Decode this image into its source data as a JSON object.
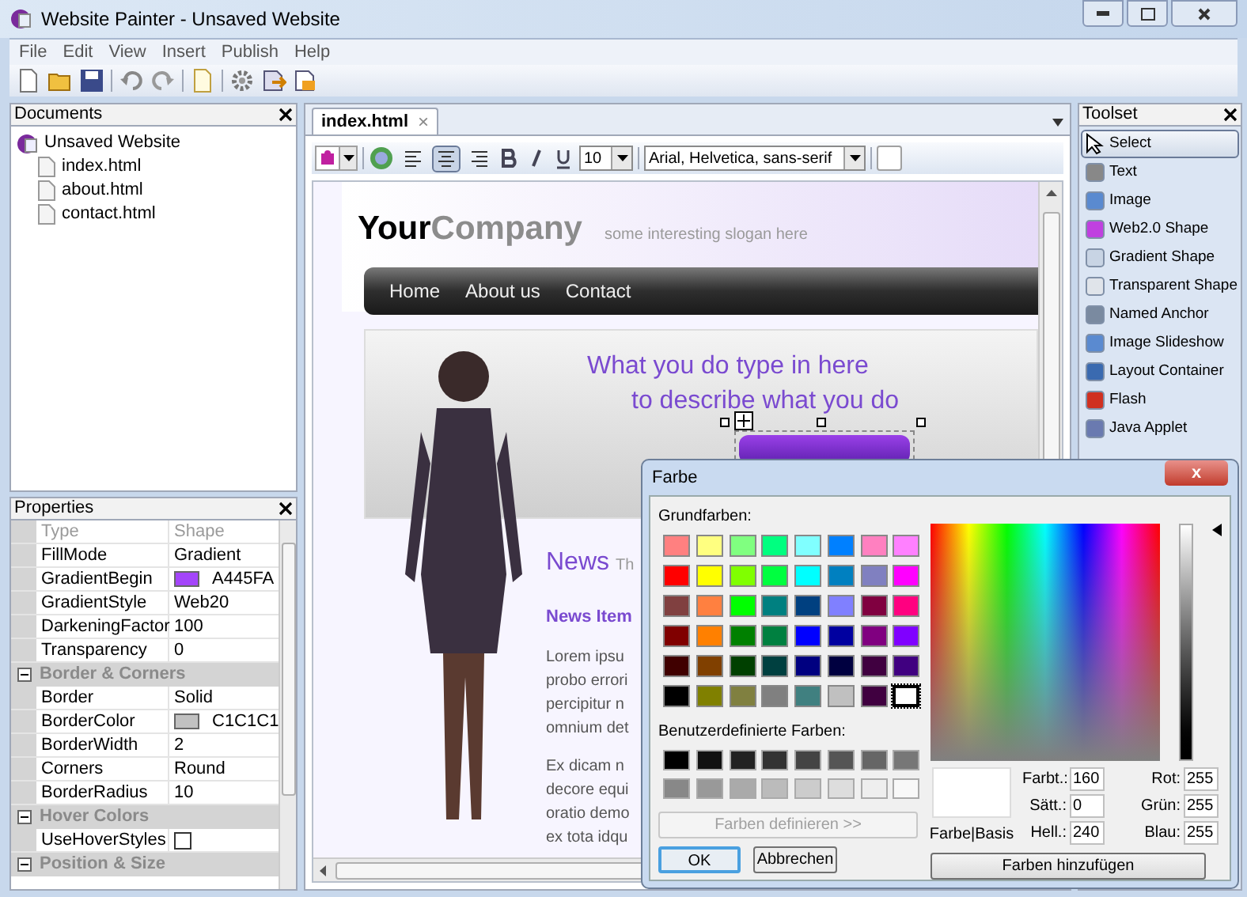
{
  "window": {
    "title": "Website Painter - Unsaved Website"
  },
  "menu": [
    "File",
    "Edit",
    "View",
    "Insert",
    "Publish",
    "Help"
  ],
  "documents_panel": {
    "title": "Documents",
    "tree": [
      {
        "label": "Unsaved Website",
        "children": [
          {
            "label": "index.html"
          },
          {
            "label": "about.html"
          },
          {
            "label": "contact.html"
          }
        ]
      }
    ]
  },
  "properties_panel": {
    "title": "Properties",
    "rows": [
      {
        "kind": "property",
        "name": "Type",
        "value": "Shape",
        "disabled": true
      },
      {
        "kind": "property",
        "name": "FillMode",
        "value": "Gradient"
      },
      {
        "kind": "color",
        "name": "GradientBegin",
        "value": "A445FA",
        "color": "#a445fa"
      },
      {
        "kind": "property",
        "name": "GradientStyle",
        "value": "Web20"
      },
      {
        "kind": "property",
        "name": "DarkeningFactor",
        "value": "100"
      },
      {
        "kind": "property",
        "name": "Transparency",
        "value": "0"
      },
      {
        "kind": "category",
        "label": "Border & Corners",
        "expanded": true
      },
      {
        "kind": "property",
        "name": "Border",
        "value": "Solid"
      },
      {
        "kind": "color",
        "name": "BorderColor",
        "value": "C1C1C1",
        "color": "#c1c1c1"
      },
      {
        "kind": "property",
        "name": "BorderWidth",
        "value": "2"
      },
      {
        "kind": "property",
        "name": "Corners",
        "value": "Round"
      },
      {
        "kind": "property",
        "name": "BorderRadius",
        "value": "10"
      },
      {
        "kind": "category",
        "label": "Hover Colors",
        "expanded": true
      },
      {
        "kind": "checkbox",
        "name": "UseHoverStyles",
        "checked": false
      },
      {
        "kind": "category",
        "label": "Position & Size",
        "expanded": true
      }
    ]
  },
  "editor": {
    "tabs": [
      {
        "label": "index.html",
        "selected": true,
        "close": "×"
      }
    ],
    "format_toolbar": {
      "alignment": [
        {
          "selected": false
        },
        {
          "selected": true
        },
        {
          "selected": false
        }
      ],
      "font_size": "10",
      "font_family": "Arial, Helvetica, sans-serif"
    },
    "page": {
      "logo_bold": "Your",
      "logo_light": "Company",
      "slogan": "some interesting slogan here",
      "nav": [
        "Home",
        "About us",
        "Contact"
      ],
      "banner_lines": [
        "What you do type in here",
        "to describe what you do"
      ],
      "news_title": "News",
      "news_subtitle": "Th",
      "news_item_title": "News Item",
      "paragraphs": [
        [
          "Lorem ipsu",
          "probo errori",
          "percipitur n",
          "omnium det"
        ],
        [
          "Ex dicam n",
          "decore equi",
          "oratio demo",
          "ex tota idqu"
        ]
      ]
    }
  },
  "toolset": {
    "title": "Toolset",
    "items": [
      {
        "label": "Select",
        "selected": true
      },
      {
        "label": "Text",
        "selected": false
      },
      {
        "label": "Image",
        "selected": false
      },
      {
        "label": "Web2.0 Shape",
        "selected": false
      },
      {
        "label": "Gradient Shape",
        "selected": false
      },
      {
        "label": "Transparent Shape",
        "selected": false
      },
      {
        "label": "Named Anchor",
        "selected": false
      },
      {
        "label": "Image Slideshow",
        "selected": false
      },
      {
        "label": "Layout Container",
        "selected": false
      },
      {
        "label": "Flash",
        "selected": false
      },
      {
        "label": "Java Applet",
        "selected": false
      }
    ]
  },
  "color_dialog": {
    "title": "Farbe",
    "basic_label": "Grundfarben:",
    "basic_colors": [
      {
        "color": "#ff8080",
        "selected": false
      },
      {
        "color": "#ffff80",
        "selected": false
      },
      {
        "color": "#80ff80",
        "selected": false
      },
      {
        "color": "#00ff80",
        "selected": false
      },
      {
        "color": "#80ffff",
        "selected": false
      },
      {
        "color": "#0080ff",
        "selected": false
      },
      {
        "color": "#ff80c0",
        "selected": false
      },
      {
        "color": "#ff80ff",
        "selected": false
      },
      {
        "color": "#ff0000",
        "selected": false
      },
      {
        "color": "#ffff00",
        "selected": false
      },
      {
        "color": "#80ff00",
        "selected": false
      },
      {
        "color": "#00ff40",
        "selected": false
      },
      {
        "color": "#00ffff",
        "selected": false
      },
      {
        "color": "#0080c0",
        "selected": false
      },
      {
        "color": "#8080c0",
        "selected": false
      },
      {
        "color": "#ff00ff",
        "selected": false
      },
      {
        "color": "#804040",
        "selected": false
      },
      {
        "color": "#ff8040",
        "selected": false
      },
      {
        "color": "#00ff00",
        "selected": false
      },
      {
        "color": "#008080",
        "selected": false
      },
      {
        "color": "#004080",
        "selected": false
      },
      {
        "color": "#8080ff",
        "selected": false
      },
      {
        "color": "#800040",
        "selected": false
      },
      {
        "color": "#ff0080",
        "selected": false
      },
      {
        "color": "#800000",
        "selected": false
      },
      {
        "color": "#ff8000",
        "selected": false
      },
      {
        "color": "#008000",
        "selected": false
      },
      {
        "color": "#008040",
        "selected": false
      },
      {
        "color": "#0000ff",
        "selected": false
      },
      {
        "color": "#0000a0",
        "selected": false
      },
      {
        "color": "#800080",
        "selected": false
      },
      {
        "color": "#8000ff",
        "selected": false
      },
      {
        "color": "#400000",
        "selected": false
      },
      {
        "color": "#804000",
        "selected": false
      },
      {
        "color": "#004000",
        "selected": false
      },
      {
        "color": "#004040",
        "selected": false
      },
      {
        "color": "#000080",
        "selected": false
      },
      {
        "color": "#000040",
        "selected": false
      },
      {
        "color": "#400040",
        "selected": false
      },
      {
        "color": "#400080",
        "selected": false
      },
      {
        "color": "#000000",
        "selected": false
      },
      {
        "color": "#808000",
        "selected": false
      },
      {
        "color": "#808040",
        "selected": false
      },
      {
        "color": "#808080",
        "selected": false
      },
      {
        "color": "#408080",
        "selected": false
      },
      {
        "color": "#c0c0c0",
        "selected": false
      },
      {
        "color": "#400040",
        "selected": false
      },
      {
        "color": "#ffffff",
        "selected": true
      }
    ],
    "custom_label": "Benutzerdefinierte Farben:",
    "custom_colors": [
      {
        "color": "#000000"
      },
      {
        "color": "#111111"
      },
      {
        "color": "#222222"
      },
      {
        "color": "#333333"
      },
      {
        "color": "#444444"
      },
      {
        "color": "#555555"
      },
      {
        "color": "#666666"
      },
      {
        "color": "#777777"
      },
      {
        "color": "#888888"
      },
      {
        "color": "#999999"
      },
      {
        "color": "#aaaaaa"
      },
      {
        "color": "#bbbbbb"
      },
      {
        "color": "#cccccc"
      },
      {
        "color": "#dddddd"
      },
      {
        "color": "#eeeeee"
      },
      {
        "color": "#f8f8f8"
      }
    ],
    "define_button": {
      "label": "Farben definieren >>",
      "disabled": true
    },
    "ok_button": "OK",
    "cancel_button": "Abbrechen",
    "preview_label": "Farbe|Basis",
    "fields_left": [
      {
        "label": "Farbt.:",
        "value": "160"
      },
      {
        "label": "Sätt.:",
        "value": "0"
      },
      {
        "label": "Hell.:",
        "value": "240"
      }
    ],
    "fields_right": [
      {
        "label": "Rot:",
        "value": "255"
      },
      {
        "label": "Grün:",
        "value": "255"
      },
      {
        "label": "Blau:",
        "value": "255"
      }
    ],
    "add_button": "Farben hinzufügen",
    "close": "x"
  }
}
